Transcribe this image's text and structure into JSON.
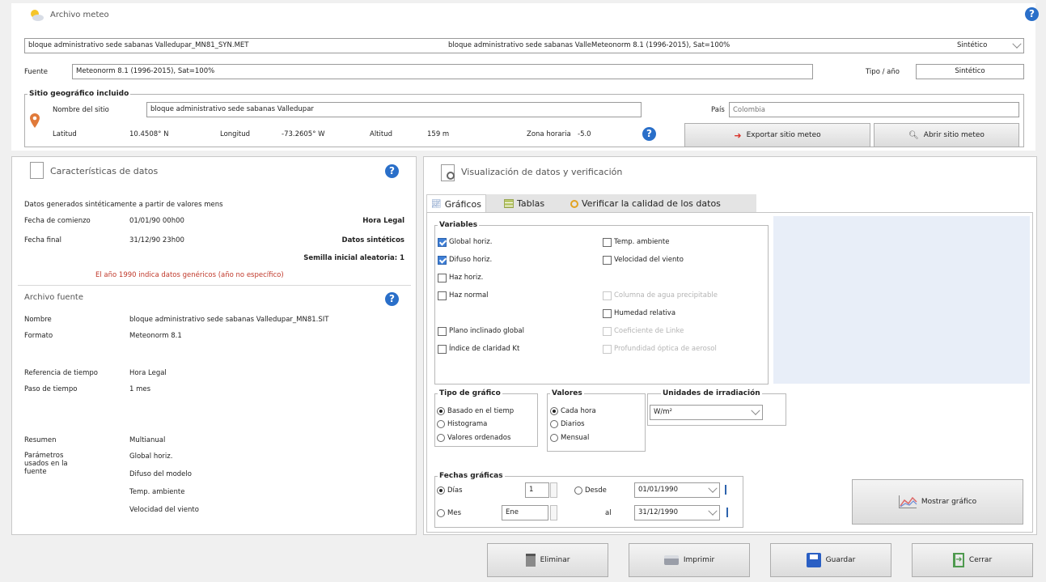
{
  "header": {
    "title": "Archivo meteo",
    "file_select": {
      "left": "bloque administrativo sede sabanas Valledupar_MN81_SYN.MET",
      "middle": "bloque administrativo sede sabanas ValleMeteonorm 8.1 (1996-2015), Sat=100%",
      "right": "Sintético"
    },
    "fuente_label": "Fuente",
    "fuente_value": "Meteonorm 8.1 (1996-2015), Sat=100%",
    "tipo_label": "Tipo / año",
    "tipo_value": "Sintético"
  },
  "site": {
    "title": "Sitio geográfico incluido",
    "name_label": "Nombre del sitio",
    "name_value": "bloque administrativo sede sabanas Valledupar",
    "pais_label": "País",
    "pais_placeholder": "Colombia",
    "lat_label": "Latitud",
    "lat_value": "10.4508° N",
    "lon_label": "Longitud",
    "lon_value": "-73.2605° W",
    "alt_label": "Altitud",
    "alt_value": "159 m",
    "tz_label": "Zona horaria",
    "tz_value": "-5.0",
    "export_label": "Exportar sitio meteo",
    "open_label": "Abrir sitio meteo"
  },
  "characteristics": {
    "title": "Características de datos",
    "generated": "Datos generados sintéticamente a partir de valores mens",
    "start_label": "Fecha de comienzo",
    "start_value": "01/01/90 00h00",
    "start_note": "Hora Legal",
    "end_label": "Fecha final",
    "end_value": "31/12/90 23h00",
    "end_note": "Datos sintéticos",
    "seed": "Semilla inicial aleatoria: 1",
    "warning": "El año 1990 indica datos genéricos (año no específico)",
    "warning_color": "#c0392b"
  },
  "source": {
    "title": "Archivo fuente",
    "rows": [
      {
        "label": "Nombre",
        "value": "bloque administrativo sede sabanas Valledupar_MN81.SIT"
      },
      {
        "label": "Formato",
        "value": "Meteonorm 8.1"
      },
      {
        "label": "Referencia de tiempo",
        "value": "Hora Legal"
      },
      {
        "label": "Paso de tiempo",
        "value": "1 mes"
      },
      {
        "label": "Resumen",
        "value": "Multianual"
      }
    ],
    "params_label": "Parámetros usados en la fuente",
    "params": [
      "Global horiz.",
      "Difuso del modelo",
      "Temp. ambiente",
      "Velocidad del viento"
    ]
  },
  "viz": {
    "title": "Visualización de datos y verificación",
    "tabs": [
      "Gráficos",
      "Tablas",
      "Verificar la calidad de los datos"
    ],
    "variables_title": "Variables",
    "left_vars": [
      {
        "label": "Global horiz.",
        "checked": true
      },
      {
        "label": "Difuso horiz.",
        "checked": true
      },
      {
        "label": "Haz horiz.",
        "checked": false
      },
      {
        "label": "Haz normal",
        "checked": false
      },
      {
        "label": "Plano inclinado global",
        "checked": false
      },
      {
        "label": "Índice de claridad Kt",
        "checked": false
      }
    ],
    "right_vars": [
      {
        "label": "Temp. ambiente",
        "enabled": true
      },
      {
        "label": "Velocidad del viento",
        "enabled": true
      },
      {
        "label": "Columna de agua precipitable",
        "enabled": false
      },
      {
        "label": "Humedad relativa",
        "enabled": true
      },
      {
        "label": "Coeficiente de Linke",
        "enabled": false
      },
      {
        "label": "Profundidad óptica de aerosol",
        "enabled": false
      }
    ],
    "chart_type_title": "Tipo de gráfico",
    "chart_types": [
      "Basado en el tiemp",
      "Histograma",
      "Valores ordenados"
    ],
    "values_title": "Valores",
    "values": [
      "Cada hora",
      "Diarios",
      "Mensual"
    ],
    "units_title": "Unidades de irradiación",
    "units_value": "W/m²",
    "dates_title": "Fechas gráficas",
    "dias_label": "Días",
    "dias_value": "1",
    "mes_label": "Mes",
    "mes_value": "Ene",
    "desde_label": "Desde",
    "desde_value": "01/01/1990",
    "al_label": "al",
    "al_value": "31/12/1990",
    "show_label": "Mostrar gráfico"
  },
  "footer": {
    "delete_label": "Eliminar",
    "print_label": "Imprimir",
    "save_label": "Guardar",
    "close_label": "Cerrar"
  },
  "colors": {
    "accent": "#2a6fc9",
    "chart_area": "#e8eef8"
  }
}
